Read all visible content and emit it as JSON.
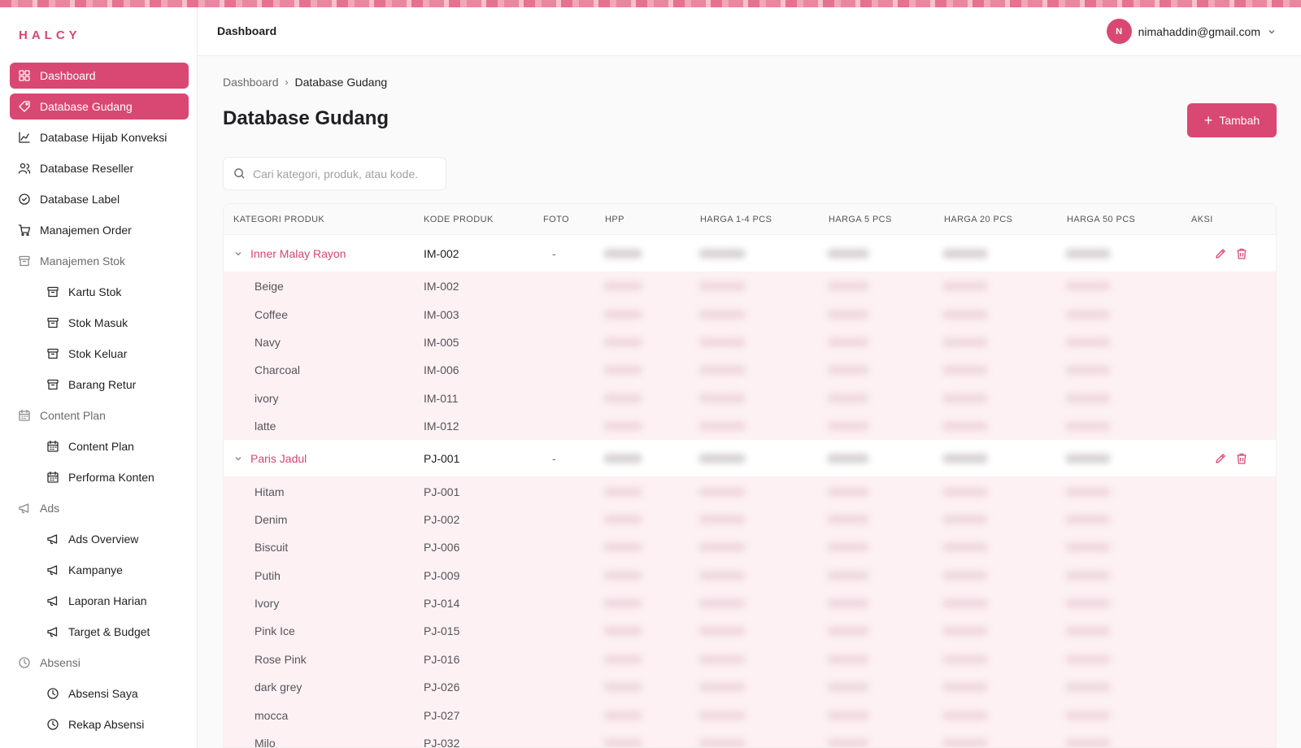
{
  "app": {
    "logo": "HALCY"
  },
  "sidebar": {
    "items": [
      {
        "label": "Dashboard",
        "icon": "grid-icon",
        "active": true
      },
      {
        "label": "Database Gudang",
        "icon": "tag-icon",
        "active": true
      },
      {
        "label": "Database Hijab Konveksi",
        "icon": "chart-icon"
      },
      {
        "label": "Database Reseller",
        "icon": "users-icon"
      },
      {
        "label": "Database Label",
        "icon": "check-circle-icon"
      },
      {
        "label": "Manajemen Order",
        "icon": "cart-icon"
      },
      {
        "label": "Manajemen Stok",
        "icon": "archive-icon",
        "section": true
      },
      {
        "label": "Kartu Stok",
        "icon": "archive-icon",
        "sub": true
      },
      {
        "label": "Stok Masuk",
        "icon": "archive-icon",
        "sub": true
      },
      {
        "label": "Stok Keluar",
        "icon": "archive-icon",
        "sub": true
      },
      {
        "label": "Barang Retur",
        "icon": "archive-icon",
        "sub": true
      },
      {
        "label": "Content Plan",
        "icon": "calendar-icon",
        "section": true
      },
      {
        "label": "Content Plan",
        "icon": "calendar-icon",
        "sub": true
      },
      {
        "label": "Performa Konten",
        "icon": "calendar-icon",
        "sub": true
      },
      {
        "label": "Ads",
        "icon": "megaphone-icon",
        "section": true
      },
      {
        "label": "Ads Overview",
        "icon": "megaphone-icon",
        "sub": true
      },
      {
        "label": "Kampanye",
        "icon": "megaphone-icon",
        "sub": true
      },
      {
        "label": "Laporan Harian",
        "icon": "megaphone-icon",
        "sub": true
      },
      {
        "label": "Target & Budget",
        "icon": "megaphone-icon",
        "sub": true
      },
      {
        "label": "Absensi",
        "icon": "clock-icon",
        "section": true
      },
      {
        "label": "Absensi Saya",
        "icon": "clock-icon",
        "sub": true
      },
      {
        "label": "Rekap Absensi",
        "icon": "clock-icon",
        "sub": true
      }
    ]
  },
  "header": {
    "title": "Dashboard",
    "user_initial": "N",
    "user_email": "nimahaddin@gmail.com"
  },
  "breadcrumb": {
    "parent": "Dashboard",
    "separator": "›",
    "current": "Database Gudang"
  },
  "page": {
    "title": "Database Gudang",
    "add_label": "Tambah"
  },
  "search": {
    "placeholder": "Cari kategori, produk, atau kode."
  },
  "table": {
    "columns": [
      "KATEGORI PRODUK",
      "KODE PRODUK",
      "FOTO",
      "HPP",
      "HARGA 1-4 PCS",
      "HARGA 5 PCS",
      "HARGA 20 PCS",
      "HARGA 50 PCS",
      "AKSI"
    ],
    "groups": [
      {
        "name": "Inner Malay Rayon",
        "code": "IM-002",
        "foto": "-",
        "variants": [
          {
            "name": "Beige",
            "code": "IM-002"
          },
          {
            "name": "Coffee",
            "code": "IM-003"
          },
          {
            "name": "Navy",
            "code": "IM-005"
          },
          {
            "name": "Charcoal",
            "code": "IM-006"
          },
          {
            "name": "ivory",
            "code": "IM-011"
          },
          {
            "name": "latte",
            "code": "IM-012"
          }
        ]
      },
      {
        "name": "Paris Jadul",
        "code": "PJ-001",
        "foto": "-",
        "variants": [
          {
            "name": "Hitam",
            "code": "PJ-001"
          },
          {
            "name": "Denim",
            "code": "PJ-002"
          },
          {
            "name": "Biscuit",
            "code": "PJ-006"
          },
          {
            "name": "Putih",
            "code": "PJ-009"
          },
          {
            "name": "Ivory",
            "code": "PJ-014"
          },
          {
            "name": "Pink Ice",
            "code": "PJ-015"
          },
          {
            "name": "Rose Pink",
            "code": "PJ-016"
          },
          {
            "name": "dark grey",
            "code": "PJ-026"
          },
          {
            "name": "mocca",
            "code": "PJ-027"
          },
          {
            "name": "Milo",
            "code": "PJ-032"
          }
        ]
      }
    ]
  },
  "colors": {
    "accent": "#d94872",
    "child_row_bg": "#fdf1f4"
  }
}
